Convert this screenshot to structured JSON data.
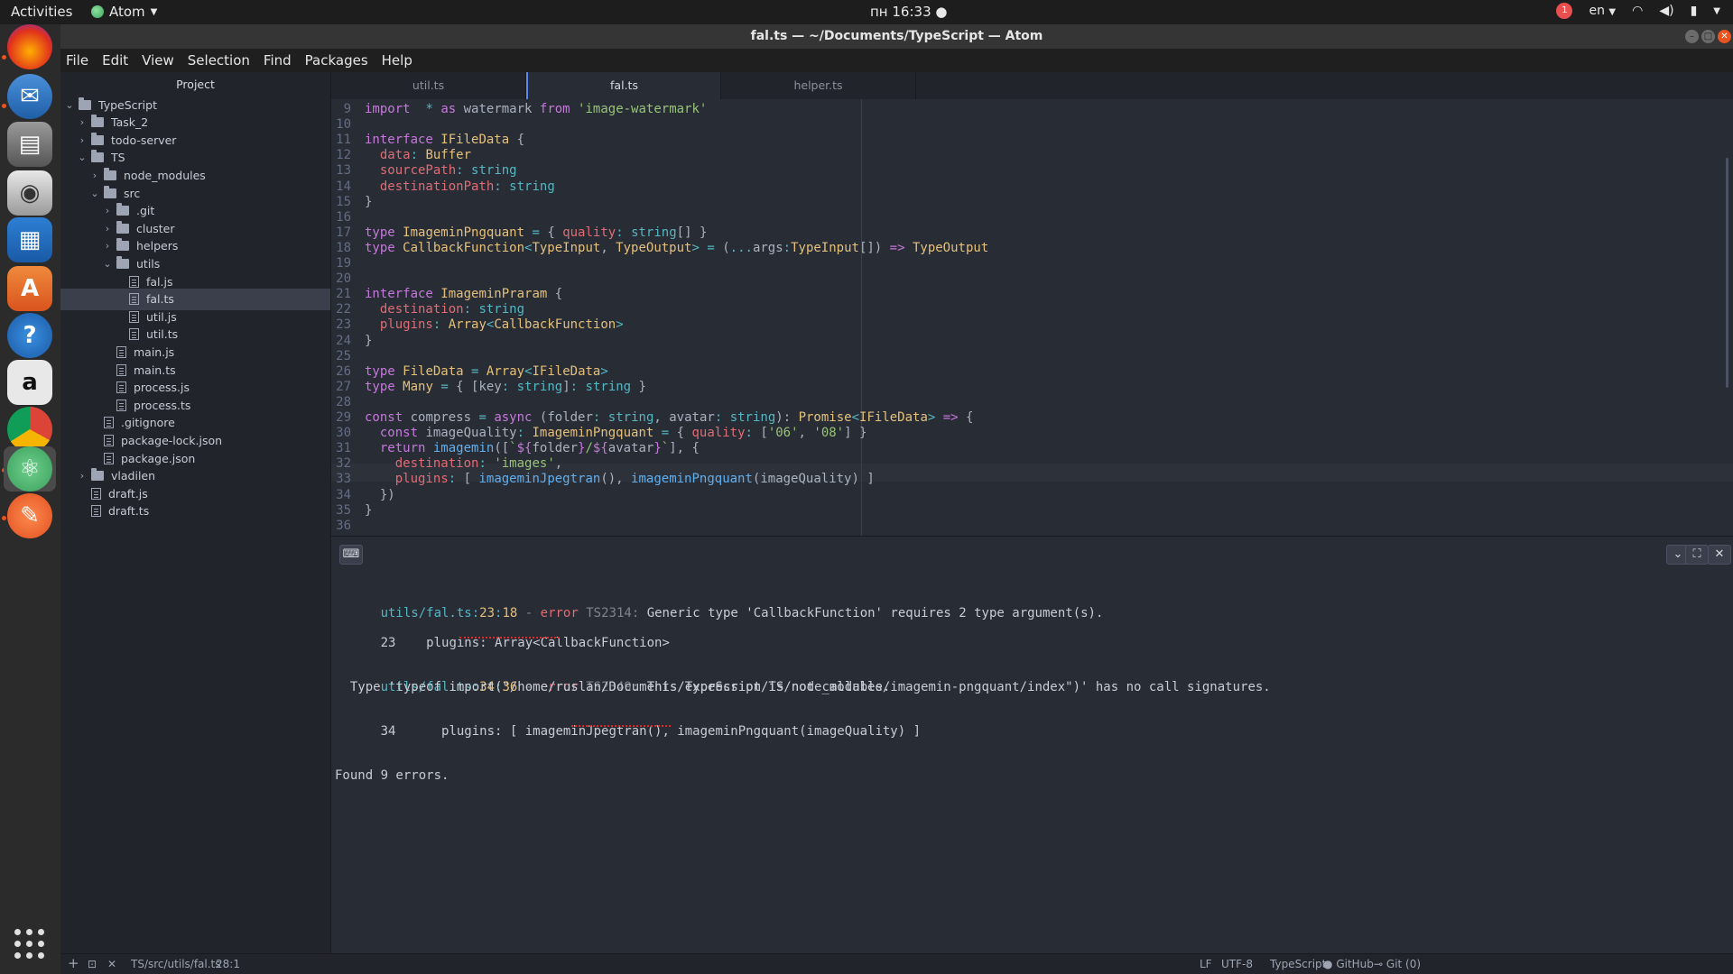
{
  "topbar": {
    "activities": "Activities",
    "app_name": "Atom",
    "clock": "пн 16:33 ●",
    "lang": "en",
    "notification_count": "1"
  },
  "window": {
    "title": "fal.ts — ~/Documents/TypeScript — Atom"
  },
  "menu": [
    "File",
    "Edit",
    "View",
    "Selection",
    "Find",
    "Packages",
    "Help"
  ],
  "tree": {
    "header": "Project",
    "nodes": [
      {
        "label": "TypeScript",
        "kind": "folder",
        "open": true,
        "depth": 0
      },
      {
        "label": "Task_2",
        "kind": "folder",
        "open": false,
        "depth": 1
      },
      {
        "label": "todo-server",
        "kind": "folder",
        "open": false,
        "depth": 1
      },
      {
        "label": "TS",
        "kind": "folder",
        "open": true,
        "depth": 1
      },
      {
        "label": "node_modules",
        "kind": "folder",
        "open": false,
        "depth": 2
      },
      {
        "label": "src",
        "kind": "folder",
        "open": true,
        "depth": 2
      },
      {
        "label": ".git",
        "kind": "folder",
        "open": false,
        "depth": 3
      },
      {
        "label": "cluster",
        "kind": "folder",
        "open": false,
        "depth": 3
      },
      {
        "label": "helpers",
        "kind": "folder",
        "open": false,
        "depth": 3
      },
      {
        "label": "utils",
        "kind": "folder",
        "open": true,
        "depth": 3
      },
      {
        "label": "fal.js",
        "kind": "file",
        "depth": 4
      },
      {
        "label": "fal.ts",
        "kind": "file",
        "depth": 4,
        "selected": true
      },
      {
        "label": "util.js",
        "kind": "file",
        "depth": 4
      },
      {
        "label": "util.ts",
        "kind": "file",
        "depth": 4
      },
      {
        "label": "main.js",
        "kind": "file",
        "depth": 3
      },
      {
        "label": "main.ts",
        "kind": "file",
        "depth": 3
      },
      {
        "label": "process.js",
        "kind": "file",
        "depth": 3
      },
      {
        "label": "process.ts",
        "kind": "file",
        "depth": 3
      },
      {
        "label": ".gitignore",
        "kind": "file",
        "depth": 2
      },
      {
        "label": "package-lock.json",
        "kind": "file",
        "depth": 2
      },
      {
        "label": "package.json",
        "kind": "file",
        "depth": 2
      },
      {
        "label": "vladilen",
        "kind": "folder",
        "open": false,
        "depth": 1
      },
      {
        "label": "draft.js",
        "kind": "file",
        "depth": 1
      },
      {
        "label": "draft.ts",
        "kind": "file",
        "depth": 1
      }
    ]
  },
  "tabs": [
    {
      "label": "util.ts",
      "active": false
    },
    {
      "label": "fal.ts",
      "active": true
    },
    {
      "label": "helper.ts",
      "active": false
    }
  ],
  "editor": {
    "lines": [
      {
        "n": "9",
        "tokens": [
          [
            "k",
            "import"
          ],
          [
            "",
            "  "
          ],
          [
            "o",
            "*"
          ],
          [
            "",
            " "
          ],
          [
            "k",
            "as"
          ],
          [
            "",
            " watermark "
          ],
          [
            "k",
            "from"
          ],
          [
            "",
            " "
          ],
          [
            "s",
            "'image-watermark'"
          ]
        ]
      },
      {
        "n": "10",
        "tokens": []
      },
      {
        "n": "11",
        "tokens": [
          [
            "k",
            "interface"
          ],
          [
            "",
            " "
          ],
          [
            "t",
            "IFileData"
          ],
          [
            "",
            " {"
          ]
        ]
      },
      {
        "n": "12",
        "tokens": [
          [
            "",
            "  "
          ],
          [
            "p",
            "data"
          ],
          [
            "o",
            ":"
          ],
          [
            "",
            " "
          ],
          [
            "t",
            "Buffer"
          ]
        ]
      },
      {
        "n": "13",
        "tokens": [
          [
            "",
            "  "
          ],
          [
            "p",
            "sourcePath"
          ],
          [
            "o",
            ":"
          ],
          [
            "",
            " "
          ],
          [
            "o",
            "string"
          ]
        ]
      },
      {
        "n": "14",
        "tokens": [
          [
            "",
            "  "
          ],
          [
            "p",
            "destinationPath"
          ],
          [
            "o",
            ":"
          ],
          [
            "",
            " "
          ],
          [
            "o",
            "string"
          ]
        ]
      },
      {
        "n": "15",
        "tokens": [
          [
            "",
            "}"
          ]
        ]
      },
      {
        "n": "16",
        "tokens": []
      },
      {
        "n": "17",
        "tokens": [
          [
            "k",
            "type"
          ],
          [
            "",
            " "
          ],
          [
            "t",
            "ImageminPngquant"
          ],
          [
            "",
            " "
          ],
          [
            "o",
            "="
          ],
          [
            "",
            " { "
          ],
          [
            "p",
            "quality"
          ],
          [
            "o",
            ":"
          ],
          [
            "",
            " "
          ],
          [
            "o",
            "string"
          ],
          [
            "",
            "[] }"
          ]
        ]
      },
      {
        "n": "18",
        "tokens": [
          [
            "k",
            "type"
          ],
          [
            "",
            " "
          ],
          [
            "t",
            "CallbackFunction"
          ],
          [
            "o",
            "<"
          ],
          [
            "t",
            "TypeInput"
          ],
          [
            "",
            ", "
          ],
          [
            "t",
            "TypeOutput"
          ],
          [
            "o",
            ">"
          ],
          [
            "",
            " "
          ],
          [
            "o",
            "="
          ],
          [
            "",
            " ("
          ],
          [
            "o",
            "..."
          ],
          [
            "",
            "args"
          ],
          [
            "o",
            ":"
          ],
          [
            "t",
            "TypeInput"
          ],
          [
            "",
            "[]) "
          ],
          [
            "k",
            "=>"
          ],
          [
            "",
            " "
          ],
          [
            "t",
            "TypeOutput"
          ]
        ]
      },
      {
        "n": "19",
        "tokens": []
      },
      {
        "n": "20",
        "tokens": []
      },
      {
        "n": "21",
        "tokens": [
          [
            "k",
            "interface"
          ],
          [
            "",
            " "
          ],
          [
            "t",
            "ImageminPraram"
          ],
          [
            "",
            " {"
          ]
        ]
      },
      {
        "n": "22",
        "tokens": [
          [
            "",
            "  "
          ],
          [
            "p",
            "destination"
          ],
          [
            "o",
            ":"
          ],
          [
            "",
            " "
          ],
          [
            "o",
            "string"
          ]
        ]
      },
      {
        "n": "23",
        "tokens": [
          [
            "",
            "  "
          ],
          [
            "p",
            "plugins"
          ],
          [
            "o",
            ":"
          ],
          [
            "",
            " "
          ],
          [
            "t",
            "Array"
          ],
          [
            "o",
            "<"
          ],
          [
            "t",
            "CallbackFunction"
          ],
          [
            "o",
            ">"
          ]
        ]
      },
      {
        "n": "24",
        "tokens": [
          [
            "",
            "}"
          ]
        ]
      },
      {
        "n": "25",
        "tokens": []
      },
      {
        "n": "26",
        "tokens": [
          [
            "k",
            "type"
          ],
          [
            "",
            " "
          ],
          [
            "t",
            "FileData"
          ],
          [
            "",
            " "
          ],
          [
            "o",
            "="
          ],
          [
            "",
            " "
          ],
          [
            "t",
            "Array"
          ],
          [
            "o",
            "<"
          ],
          [
            "t",
            "IFileData"
          ],
          [
            "o",
            ">"
          ]
        ]
      },
      {
        "n": "27",
        "tokens": [
          [
            "k",
            "type"
          ],
          [
            "",
            " "
          ],
          [
            "t",
            "Many"
          ],
          [
            "",
            " "
          ],
          [
            "o",
            "="
          ],
          [
            "",
            " { [key"
          ],
          [
            "o",
            ":"
          ],
          [
            "",
            " "
          ],
          [
            "o",
            "string"
          ],
          [
            "",
            "]"
          ],
          [
            "o",
            ":"
          ],
          [
            "",
            " "
          ],
          [
            "o",
            "string"
          ],
          [
            "",
            " }"
          ]
        ]
      },
      {
        "n": "28",
        "tokens": []
      },
      {
        "n": "29",
        "tokens": [
          [
            "k",
            "const"
          ],
          [
            "",
            " compress "
          ],
          [
            "o",
            "="
          ],
          [
            "",
            " "
          ],
          [
            "k",
            "async"
          ],
          [
            "",
            " (folder"
          ],
          [
            "o",
            ":"
          ],
          [
            "",
            " "
          ],
          [
            "o",
            "string"
          ],
          [
            "",
            ", avatar"
          ],
          [
            "o",
            ":"
          ],
          [
            "",
            " "
          ],
          [
            "o",
            "string"
          ],
          [
            "",
            "): "
          ],
          [
            "t",
            "Promise"
          ],
          [
            "o",
            "<"
          ],
          [
            "t",
            "IFileData"
          ],
          [
            "o",
            ">"
          ],
          [
            "",
            " "
          ],
          [
            "k",
            "=>"
          ],
          [
            "",
            " {"
          ]
        ]
      },
      {
        "n": "30",
        "tokens": [
          [
            "",
            "  "
          ],
          [
            "k",
            "const"
          ],
          [
            "",
            " imageQuality"
          ],
          [
            "o",
            ":"
          ],
          [
            "",
            " "
          ],
          [
            "t",
            "ImageminPngquant"
          ],
          [
            "",
            " "
          ],
          [
            "o",
            "="
          ],
          [
            "",
            " { "
          ],
          [
            "p",
            "quality"
          ],
          [
            "o",
            ":"
          ],
          [
            "",
            " ["
          ],
          [
            "s",
            "'06'"
          ],
          [
            "",
            ", "
          ],
          [
            "s",
            "'08'"
          ],
          [
            "",
            "] }"
          ]
        ]
      },
      {
        "n": "31",
        "tokens": [
          [
            "",
            "  "
          ],
          [
            "k",
            "return"
          ],
          [
            "",
            " "
          ],
          [
            "f",
            "imagemin"
          ],
          [
            "",
            "(["
          ],
          [
            "s",
            "`"
          ],
          [
            "k",
            "${"
          ],
          [
            "",
            "folder"
          ],
          [
            "k",
            "}"
          ],
          [
            "s",
            "/"
          ],
          [
            "k",
            "${"
          ],
          [
            "",
            "avatar"
          ],
          [
            "k",
            "}"
          ],
          [
            "s",
            "`"
          ],
          [
            "",
            "], {"
          ]
        ]
      },
      {
        "n": "32",
        "tokens": [
          [
            "",
            "    "
          ],
          [
            "p",
            "destination"
          ],
          [
            "o",
            ":"
          ],
          [
            "",
            " "
          ],
          [
            "s",
            "'images'"
          ],
          [
            "",
            ","
          ]
        ]
      },
      {
        "n": "33",
        "tokens": [
          [
            "",
            "    "
          ],
          [
            "p",
            "plugins"
          ],
          [
            "o",
            ":"
          ],
          [
            "",
            " [ "
          ],
          [
            "f",
            "imageminJpegtran"
          ],
          [
            "",
            "(), "
          ],
          [
            "f",
            "imageminPngquant"
          ],
          [
            "",
            "(imageQuality) ]"
          ]
        ]
      },
      {
        "n": "34",
        "tokens": [
          [
            "",
            "  })"
          ]
        ]
      },
      {
        "n": "35",
        "tokens": [
          [
            "",
            "}"
          ]
        ]
      },
      {
        "n": "36",
        "tokens": []
      }
    ]
  },
  "panel": {
    "errors": [
      {
        "file": "utils/fal.ts",
        "line": "23",
        "col": "18",
        "label": "error",
        "code": "TS2314",
        "message": "Generic type 'CallbackFunction' requires 2 type argument(s).",
        "snippet_line": "23",
        "snippet": "  plugins: Array<CallbackFunction>"
      },
      {
        "file": "utils/fal.ts",
        "line": "34",
        "col": "36",
        "label": "error",
        "code": "TS2349",
        "message": "This expression is not callable.",
        "detail": "  Type 'typeof import(\"/home/ruslan/Documents/TypeScript/TS/node_modules/imagemin-pngquant/index\")' has no call signatures.",
        "snippet_line": "34",
        "snippet": "    plugins: [ imageminJpegtran(), imageminPngquant(imageQuality) ]"
      }
    ],
    "summary": "Found 9 errors."
  },
  "status": {
    "path": "TS/src/utils/fal.ts",
    "cursor": "28:1",
    "eol": "LF",
    "encoding": "UTF-8",
    "grammar": "TypeScript",
    "github": "GitHub",
    "git": "Git (0)"
  },
  "colors": {
    "accent": "#568af2",
    "error": "#e06c75",
    "editor_bg": "#282c34",
    "tree_bg": "#21252b"
  }
}
